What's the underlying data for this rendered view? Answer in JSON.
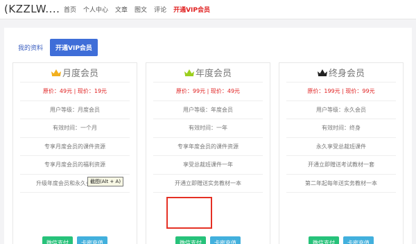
{
  "header": {
    "logo": "(KZZLW....",
    "nav": [
      "首页",
      "个人中心",
      "文章",
      "图文",
      "评论"
    ],
    "nav_vip": "开通VIP会员"
  },
  "tabs": {
    "profile": "我的资料",
    "vip": "开通VIP会员"
  },
  "cards": [
    {
      "title": "月度会员",
      "crown_color": "#f2b01e",
      "price": "原价：49元 | 现价：19元",
      "rows": [
        "用户等级：月度会员",
        "有效时间：一个月",
        "专享月度会员的课件资源",
        "专享月度会员的福利资源",
        "升级年度会员和永久会员享优惠"
      ],
      "pay": "微信支付",
      "card": "卡密充值"
    },
    {
      "title": "年度会员",
      "crown_color": "#9bcf1e",
      "price": "原价：99元 | 现价：49元",
      "rows": [
        "用户等级：年度会员",
        "有效时间：一年",
        "专享年度会员的课件资源",
        "享受总裁班课件一年",
        "开通立即赠送实务教材一本"
      ],
      "pay": "微信支付",
      "card": "卡密充值"
    },
    {
      "title": "终身会员",
      "crown_color": "#222222",
      "price": "原价：199元 | 现价：99元",
      "rows": [
        "用户等级：永久会员",
        "有效时间：终身",
        "永久享受总裁班课件",
        "开通立即赠送考试教材一套",
        "第二年起每年送实务教材一本"
      ],
      "pay": "微信支付",
      "card": "卡密充值"
    }
  ],
  "tooltip": "截图(Alt + A)"
}
